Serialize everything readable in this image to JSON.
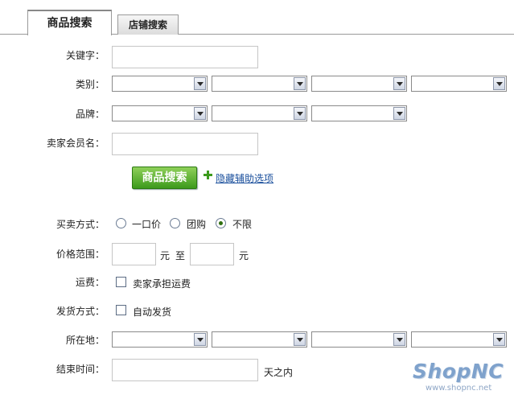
{
  "tabs": [
    {
      "label": "商品搜索",
      "active": true
    },
    {
      "label": "店铺搜索",
      "active": false
    }
  ],
  "form": {
    "keyword_label": "关键字：",
    "keyword_value": "",
    "category_label": "类别：",
    "brand_label": "品牌：",
    "seller_label": "卖家会员名：",
    "seller_value": "",
    "search_button": "商品搜索",
    "toggle_link": "隐藏辅助选项",
    "trade_label": "买卖方式：",
    "trade_options": [
      {
        "label": "一口价",
        "checked": false
      },
      {
        "label": "团购",
        "checked": false
      },
      {
        "label": "不限",
        "checked": true
      }
    ],
    "price_label": "价格范围：",
    "price_unit": "元",
    "price_to": "至",
    "price_min": "",
    "price_max": "",
    "shipping_label": "运费：",
    "shipping_option": "卖家承担运费",
    "delivery_label": "发货方式：",
    "delivery_option": "自动发货",
    "location_label": "所在地：",
    "endtime_label": "结束时间：",
    "endtime_value": "",
    "endtime_unit": "天之内"
  },
  "logo": {
    "text": "ShopNC",
    "url": "www.shopnc.net"
  },
  "colors": {
    "button_green": "#3c9a1c",
    "link_blue": "#1a4f9c",
    "logo_blue": "#7fa2cc"
  }
}
